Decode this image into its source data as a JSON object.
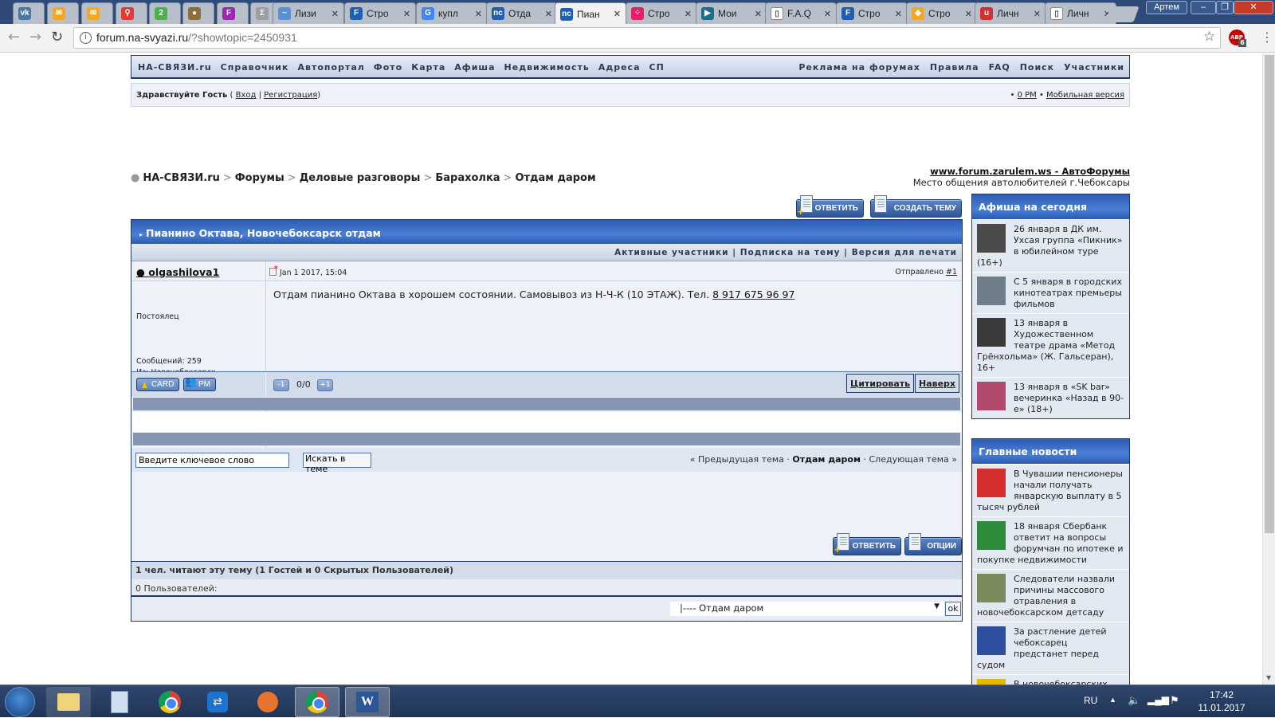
{
  "browser": {
    "tabs": [
      {
        "label": "",
        "icon": "vk-icon",
        "color": "#4a76a8",
        "glyph": "vk"
      },
      {
        "label": "",
        "icon": "yandex-mail-icon",
        "color": "#f5a623",
        "glyph": "✉"
      },
      {
        "label": "",
        "icon": "yandex-mail-icon",
        "color": "#f5a623",
        "glyph": "✉"
      },
      {
        "label": "",
        "icon": "map-pin-icon",
        "color": "#e53935",
        "glyph": "⚲"
      },
      {
        "label": "",
        "icon": "2gis-icon",
        "color": "#4caf50",
        "glyph": "2"
      },
      {
        "label": "",
        "icon": "muffin-icon",
        "color": "#8d6e3a",
        "glyph": "●"
      },
      {
        "label": "",
        "icon": "app-icon",
        "color": "#9c27b0",
        "glyph": "F"
      },
      {
        "label": "",
        "icon": "sigma-icon",
        "color": "#9e9e9e",
        "glyph": "Σ"
      },
      {
        "label": "Лизи",
        "icon": "leasing-icon",
        "color": "#5b8fd6",
        "glyph": "~"
      },
      {
        "label": "Стро",
        "icon": "f-icon",
        "color": "#1e5fb3",
        "glyph": "F"
      },
      {
        "label": "купл",
        "icon": "google-icon",
        "color": "#4285f4",
        "glyph": "G"
      },
      {
        "label": "Отда",
        "icon": "ns-icon",
        "color": "#1e5fb3",
        "glyph": "nc"
      },
      {
        "label": "Пиан",
        "icon": "ns-icon",
        "color": "#1e5fb3",
        "glyph": "nc",
        "active": true
      },
      {
        "label": "Стро",
        "icon": "dots-icon",
        "color": "#e91e63",
        "glyph": "⁘"
      },
      {
        "label": "Мои",
        "icon": "play-icon",
        "color": "#1a6f8f",
        "glyph": "▶"
      },
      {
        "label": "F.A.Q",
        "icon": "page-icon",
        "color": "#ffffff",
        "glyph": "▯"
      },
      {
        "label": "Стро",
        "icon": "f-icon",
        "color": "#1e5fb3",
        "glyph": "F"
      },
      {
        "label": "Стро",
        "icon": "diamond-icon",
        "color": "#f5a623",
        "glyph": "◆"
      },
      {
        "label": "Личн",
        "icon": "u-icon",
        "color": "#d32f2f",
        "glyph": "u"
      },
      {
        "label": "Личн",
        "icon": "page-icon",
        "color": "#ffffff",
        "glyph": "▯"
      }
    ],
    "profile_name": "Артем",
    "url_host": "forum.na-svyazi.ru",
    "url_path": "/?showtopic=2450931",
    "abp_count": "6",
    "abp_label": "ABP"
  },
  "topnav": {
    "left": [
      "НА-СВЯЗИ.ru",
      "Справочник",
      "Автопортал",
      "Фото",
      "Карта",
      "Афиша",
      "Недвижимость",
      "Адреса",
      "СП"
    ],
    "right": [
      "Реклама на форумах",
      "Правила",
      "FAQ",
      "Поиск",
      "Участники"
    ]
  },
  "userbar": {
    "greeting": "Здравствуйте Гость",
    "open_paren": " ( ",
    "login": "Вход",
    "sep": " | ",
    "register": "Регистрация",
    "close_paren": ")",
    "pm": "0 PM",
    "mobile": "Мобильная версия"
  },
  "breadcrumb": [
    "НА-СВЯЗИ.ru",
    "Форумы",
    "Деловые разговоры",
    "Барахолка",
    "Отдам даром"
  ],
  "ad": {
    "title": "www.forum.zarulem.ws - АвтоФорумы",
    "desc": "Место общения автолюбителей г.Чебоксары"
  },
  "buttons": {
    "reply": "ОТВЕТИТЬ",
    "new_topic": "СОЗДАТЬ ТЕМУ",
    "options": "ОПЦИИ"
  },
  "topic": {
    "title": "Пианино Октава, Новочебоксарск отдам",
    "links": [
      "Активные участники",
      "Подписка на тему",
      "Версия для печати"
    ],
    "post": {
      "author": "olgashilova1",
      "date": "Jan 1 2017, 15:04",
      "sent_label": "Отправлено",
      "number": "#1",
      "body": "Отдам пианино Октава в хорошем состоянии. Самовывоз из Н-Ч-К (10 ЭТАЖ). Тел.",
      "phone": "8 917 675 96 97",
      "rank": "Постоялец",
      "posts_label": "Сообщений:",
      "posts": "259",
      "from_label": "Из:",
      "from": "Новочебоксарск",
      "card": "CARD",
      "pm": "PM",
      "rep_minus": "-1",
      "rep_value": "0/0",
      "rep_plus": "+1",
      "quote": "Цитировать",
      "top": "Наверх"
    },
    "search_placeholder": "Введите ключевое слово",
    "search_button": "Искать в теме",
    "prev_topic": "« Предыдущая тема",
    "current_forum": "Отдам даром",
    "next_topic": "Следующая тема »"
  },
  "readers": {
    "summary": "1 чел. читают эту тему (1 Гостей и 0 Скрытых Пользователей)",
    "users": "0 Пользователей:",
    "jump_selected": "|---- Отдам даром",
    "ok": "ok"
  },
  "sidebar": {
    "afisha": {
      "title": "Афиша на сегодня",
      "items": [
        {
          "text": "26 января в ДК им. Ухсая группа «Пикник» в юбилейном туре (16+)",
          "thumb": "#4a4a4a"
        },
        {
          "text": "С 5 января в городских кинотеатрах премьеры фильмов",
          "thumb": "#6f7d8a"
        },
        {
          "text": "13 января в Художественном театре драма «Метод Грёнхольма» (Ж. Гальсеран), 16+",
          "thumb": "#3a3a3a"
        },
        {
          "text": "13 января в «SK bar» вечеринка «Назад в 90-е» (18+)",
          "thumb": "#b04a6a"
        }
      ]
    },
    "news": {
      "title": "Главные новости",
      "items": [
        {
          "text": "В Чувашии пенсионеры начали получать январскую выплату в 5 тысяч рублей",
          "thumb": "#d32f2f"
        },
        {
          "text": "18 января Сбербанк ответит на вопросы форумчан по ипотеке и покупке недвижимости",
          "thumb": "#2e8b3a"
        },
        {
          "text": "Следователи назвали причины массового отравления в новочебоксарском детсаду",
          "thumb": "#7a8a5a"
        },
        {
          "text": "За растление детей чебоксарец предстанет перед судом",
          "thumb": "#2d4f9e"
        },
        {
          "text": "В новочебоксарских",
          "thumb": "#e6b800"
        }
      ]
    }
  },
  "taskbar": {
    "lang": "RU",
    "time": "17:42",
    "date": "11.01.2017"
  }
}
